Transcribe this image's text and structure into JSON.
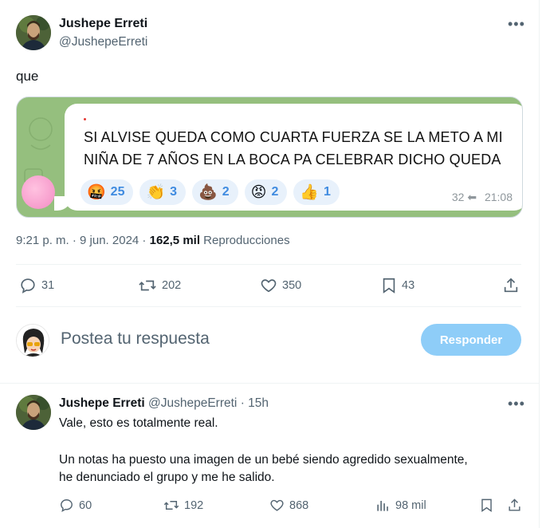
{
  "tweet": {
    "author_name": "Jushepe Erreti",
    "author_handle": "@JushepeErreti",
    "more_icon": "more-dots-icon",
    "text": "que",
    "media": {
      "message_line_1": "SI ALVISE QUEDA COMO CUARTA FUERZA SE LA METO A MI",
      "message_line_2": "NIÑA DE 7 AÑOS EN LA BOCA PA CELEBRAR DICHO QUEDA",
      "reactions": [
        {
          "emoji": "🤬",
          "count": "25"
        },
        {
          "emoji": "👏",
          "count": "3"
        },
        {
          "emoji": "💩",
          "count": "2"
        },
        {
          "emoji": "😡",
          "count": "2"
        },
        {
          "emoji": "👍",
          "count": "1"
        }
      ],
      "views": "32",
      "time": "21:08",
      "bg_color": "#95bf7e"
    },
    "timestamp": "9:21 p. m. · 9 jun. 2024",
    "separator": " · ",
    "view_count": "162,5 mil",
    "view_label": "Reproducciones",
    "actions": {
      "replies": "31",
      "retweets": "202",
      "likes": "350",
      "bookmarks": "43"
    }
  },
  "reply_box": {
    "placeholder": "Postea tu respuesta",
    "button_label": "Responder",
    "button_color": "#8ecdf8"
  },
  "reply": {
    "author_name": "Jushepe Erreti",
    "author_handle": "@JushepeErreti",
    "time_ago": "15h",
    "dot": "·",
    "line_1": "Vale, esto es totalmente real.",
    "line_2": "Un notas ha puesto una imagen de un bebé siendo agredido sexualmente,",
    "line_3": "he denunciado el grupo y me he salido.",
    "actions": {
      "replies": "60",
      "retweets": "192",
      "likes": "868",
      "views": "98 mil"
    }
  }
}
